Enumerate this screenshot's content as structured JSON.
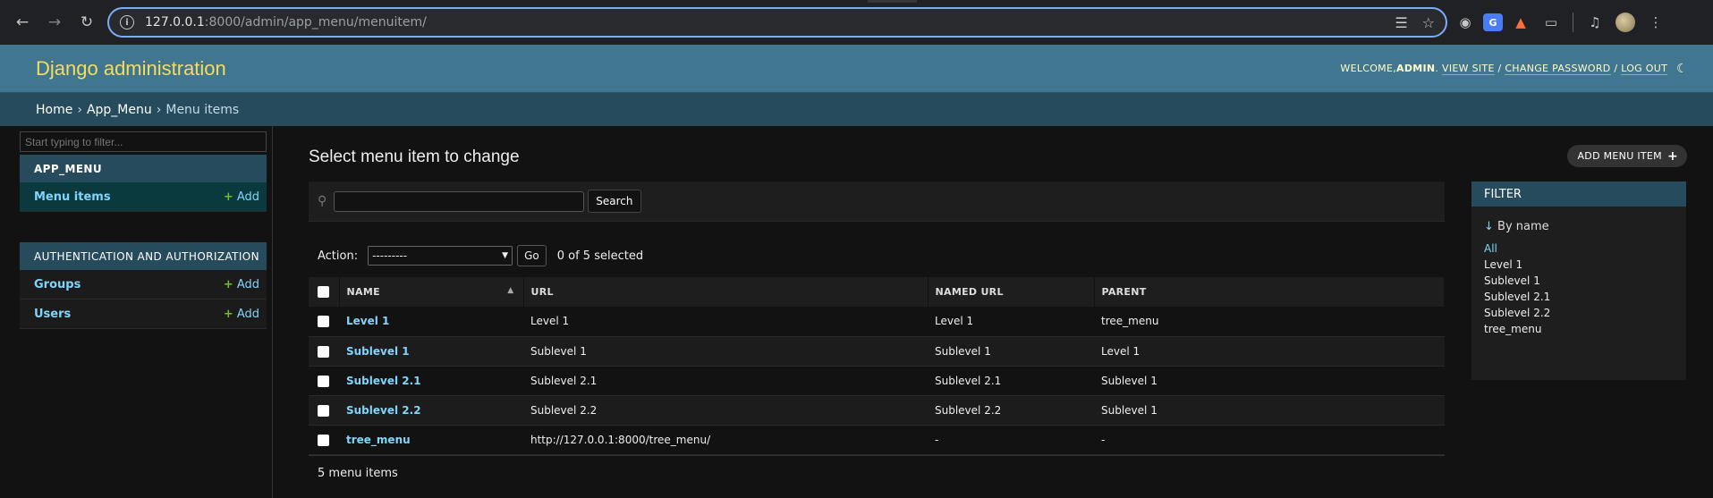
{
  "browser": {
    "url_host": "127.0.0.1",
    "url_path": ":8000/admin/app_menu/menuitem/"
  },
  "header": {
    "brand": "Django administration",
    "welcome": "WELCOME, ",
    "username": "ADMIN",
    "view_site": "VIEW SITE",
    "change_password": "CHANGE PASSWORD",
    "log_out": "LOG OUT"
  },
  "breadcrumbs": {
    "home": "Home",
    "app": "App_Menu",
    "current": "Menu items"
  },
  "sidebar": {
    "filter_placeholder": "Start typing to filter...",
    "apps": [
      {
        "caption": "APP_MENU",
        "models": [
          {
            "name": "Menu items",
            "add": "Add"
          }
        ]
      },
      {
        "caption": "AUTHENTICATION AND AUTHORIZATION",
        "models": [
          {
            "name": "Groups",
            "add": "Add"
          },
          {
            "name": "Users",
            "add": "Add"
          }
        ]
      }
    ]
  },
  "content": {
    "title": "Select menu item to change",
    "add_button": "ADD MENU ITEM",
    "search_button": "Search",
    "action_label": "Action:",
    "action_selected": "---------",
    "go_button": "Go",
    "counter": "0 of 5 selected",
    "columns": [
      "NAME",
      "URL",
      "NAMED URL",
      "PARENT"
    ],
    "rows": [
      {
        "name": "Level 1",
        "url": "Level 1",
        "named_url": "Level 1",
        "parent": "tree_menu"
      },
      {
        "name": "Sublevel 1",
        "url": "Sublevel 1",
        "named_url": "Sublevel 1",
        "parent": "Level 1"
      },
      {
        "name": "Sublevel 2.1",
        "url": "Sublevel 2.1",
        "named_url": "Sublevel 2.1",
        "parent": "Sublevel 1"
      },
      {
        "name": "Sublevel 2.2",
        "url": "Sublevel 2.2",
        "named_url": "Sublevel 2.2",
        "parent": "Sublevel 1"
      },
      {
        "name": "tree_menu",
        "url": "http://127.0.0.1:8000/tree_menu/",
        "named_url": "-",
        "parent": "-"
      }
    ],
    "paginator": "5 menu items"
  },
  "filter": {
    "title": "FILTER",
    "by_name": "By name",
    "arrow": "↓",
    "options": [
      "All",
      "Level 1",
      "Sublevel 1",
      "Sublevel 2.1",
      "Sublevel 2.2",
      "tree_menu"
    ],
    "selected_index": 0
  },
  "colors": {
    "header_bg": "#417690",
    "breadcrumb_bg": "#264b5d",
    "brand": "#f5dd5d",
    "link": "#81d4fa",
    "add_plus": "#70bf2b"
  }
}
